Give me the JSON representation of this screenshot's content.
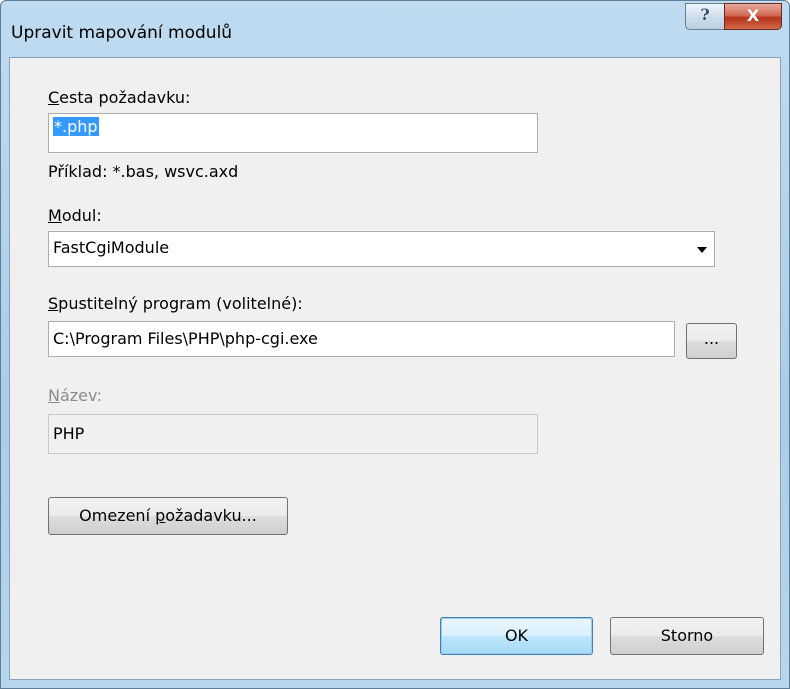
{
  "window": {
    "title": "Upravit mapování modulů",
    "help_glyph": "?",
    "close_glyph": "X"
  },
  "request_path": {
    "label_accel": "C",
    "label_rest": "esta požadavku:",
    "value": "*.php",
    "example": "Příklad: *.bas, wsvc.axd"
  },
  "module": {
    "label_accel": "M",
    "label_rest": "odul:",
    "selected": "FastCgiModule"
  },
  "executable": {
    "label_accel": "S",
    "label_rest": "pustitelný program (volitelné):",
    "value": "C:\\Program Files\\PHP\\php-cgi.exe",
    "browse_label": "..."
  },
  "name": {
    "label_accel": "N",
    "label_rest": "ázev:",
    "value": "PHP"
  },
  "restrictions_button": {
    "label_pre": "Omezení ",
    "label_accel": "p",
    "label_post": "ožadavku..."
  },
  "footer": {
    "ok_label": "OK",
    "cancel_label": "Storno"
  },
  "colors": {
    "titlebar": "#bfdbf0",
    "client": "#f0f0f0",
    "selection": "#3399ff",
    "close_button": "#c8462c"
  }
}
